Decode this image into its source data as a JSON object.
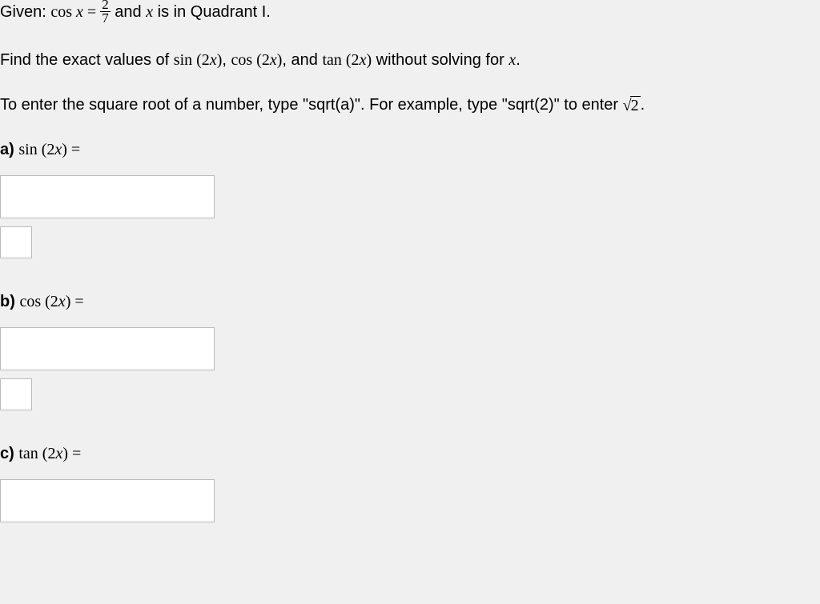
{
  "given": {
    "prefix": "Given: ",
    "func": "cos",
    "var": "x",
    "equals": " = ",
    "frac_num": "2",
    "frac_den": "7",
    "suffix1": " and ",
    "suffix2": " is in Quadrant I."
  },
  "find": {
    "prefix": "Find the exact values of ",
    "f1": "sin",
    "arg1a": "(2",
    "argx": "x",
    "arg1b": ")",
    "comma": ", ",
    "f2": "cos",
    "and": ", and ",
    "f3": "tan",
    "suffix": " without solving for ",
    "period": "."
  },
  "hint": {
    "part1": "To enter the square root of a number, type \"sqrt(a)\". For example, type \"sqrt(2)\" to enter ",
    "rad_sym": "√",
    "rad_arg": "2",
    "period": "."
  },
  "parts": {
    "a": {
      "label": "a)",
      "func": "sin",
      "lpar": " (2",
      "x": "x",
      "rpar": ") ="
    },
    "b": {
      "label": "b)",
      "func": "cos",
      "lpar": " (2",
      "x": "x",
      "rpar": ") ="
    },
    "c": {
      "label": "c)",
      "func": "tan",
      "lpar": " (2",
      "x": "x",
      "rpar": ") ="
    }
  },
  "answers": {
    "a_main": "",
    "a_small": "",
    "b_main": "",
    "b_small": "",
    "c_main": ""
  }
}
